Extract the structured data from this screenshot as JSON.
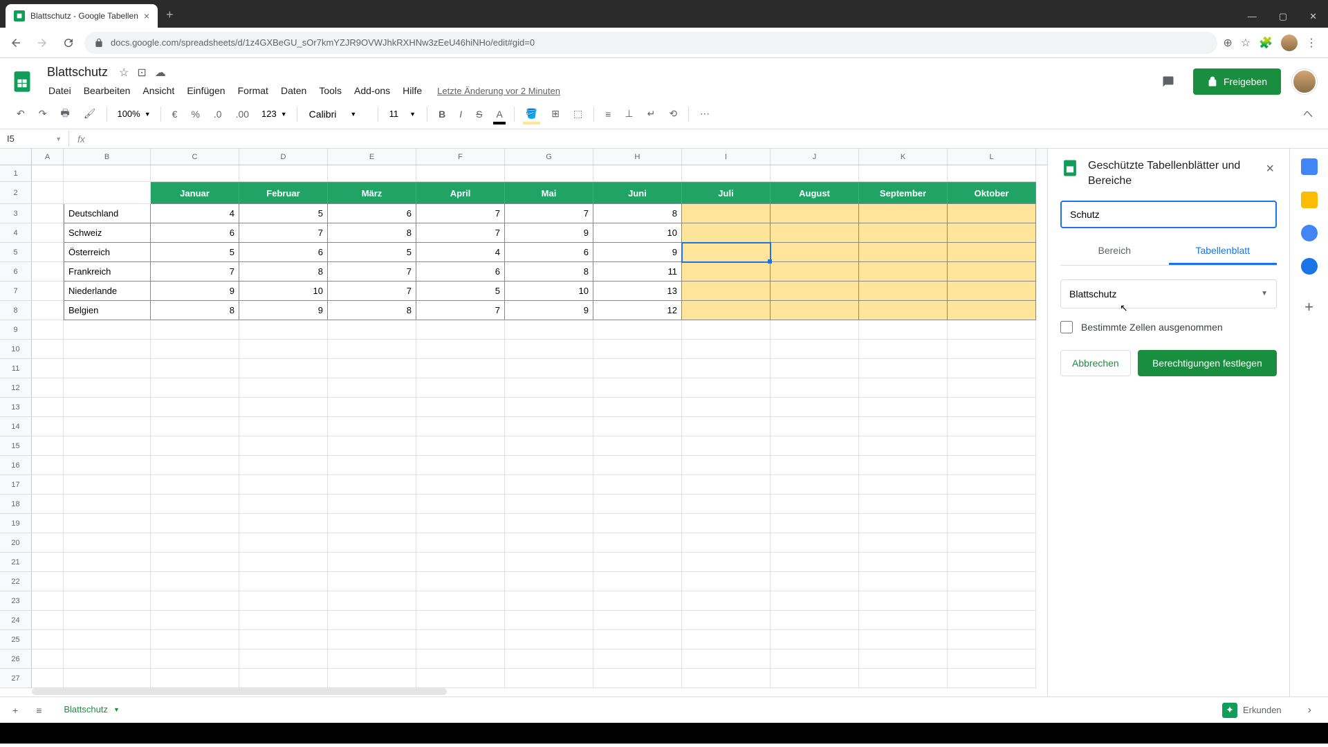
{
  "browser": {
    "tab_title": "Blattschutz - Google Tabellen",
    "url": "docs.google.com/spreadsheets/d/1z4GXBeGU_sOr7kmYZJR9OVWJhkRXHNw3zEeU46hiNHo/edit#gid=0"
  },
  "doc": {
    "title": "Blattschutz",
    "last_edit": "Letzte Änderung vor 2 Minuten"
  },
  "menu": [
    "Datei",
    "Bearbeiten",
    "Ansicht",
    "Einfügen",
    "Format",
    "Daten",
    "Tools",
    "Add-ons",
    "Hilfe"
  ],
  "share_label": "Freigeben",
  "toolbar": {
    "zoom": "100%",
    "format_num": "123",
    "font": "Calibri",
    "font_size": "11"
  },
  "name_box": "I5",
  "columns": [
    "A",
    "B",
    "C",
    "D",
    "E",
    "F",
    "G",
    "H",
    "I",
    "J",
    "K",
    "L"
  ],
  "table": {
    "headers": [
      "Januar",
      "Februar",
      "März",
      "April",
      "Mai",
      "Juni",
      "Juli",
      "August",
      "September",
      "Oktober"
    ],
    "rows": [
      {
        "country": "Deutschland",
        "vals": [
          "4",
          "5",
          "6",
          "7",
          "7",
          "8"
        ]
      },
      {
        "country": "Schweiz",
        "vals": [
          "6",
          "7",
          "8",
          "7",
          "9",
          "10"
        ]
      },
      {
        "country": "Österreich",
        "vals": [
          "5",
          "6",
          "5",
          "4",
          "6",
          "9"
        ]
      },
      {
        "country": "Frankreich",
        "vals": [
          "7",
          "8",
          "7",
          "6",
          "8",
          "11"
        ]
      },
      {
        "country": "Niederlande",
        "vals": [
          "9",
          "10",
          "7",
          "5",
          "10",
          "13"
        ]
      },
      {
        "country": "Belgien",
        "vals": [
          "8",
          "9",
          "8",
          "7",
          "9",
          "12"
        ]
      }
    ]
  },
  "sidebar": {
    "title": "Geschützte Tabellenblätter und Bereiche",
    "input_value": "Schutz",
    "tab_range": "Bereich",
    "tab_sheet": "Tabellenblatt",
    "select_value": "Blattschutz",
    "checkbox_label": "Bestimmte Zellen ausgenommen",
    "cancel": "Abbrechen",
    "confirm": "Berechtigungen festlegen"
  },
  "sheet_tab": "Blattschutz",
  "explore": "Erkunden"
}
